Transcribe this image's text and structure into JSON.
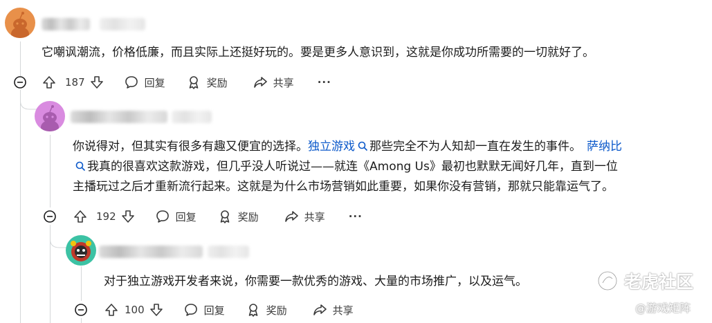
{
  "comments": [
    {
      "text": "它嘲讽潮流，价格低廉，而且实际上还挺好玩的。要是更多人意识到，这就是你成功所需要的一切就好了。",
      "score": "187",
      "reply_label": "回复",
      "award_label": "奖励",
      "share_label": "共享",
      "more_label": "···"
    },
    {
      "text_1": "你说得对，但其实有很多有趣又便宜的选择。",
      "link_1": "独立游戏",
      "text_2": "那些完全不为人知却一直在发生的事件。",
      "link_2": "萨纳比",
      "text_3": "我真的很喜欢这款游戏，但几乎没人听说过——就连《Among Us》最初也默默无闻好几年，直到一位",
      "text_4": "主播玩过之后才重新流行起来。这就是为什么市场营销如此重要，如果你没有营销，那就只能靠运气了。",
      "score": "192",
      "reply_label": "回复",
      "award_label": "奖励",
      "share_label": "共享",
      "more_label": "···"
    },
    {
      "text": "对于独立游戏开发者来说，你需要一款优秀的游戏、大量的市场推广，以及运气。",
      "score": "100",
      "reply_label": "回复",
      "award_label": "奖励",
      "share_label": "共享"
    }
  ],
  "watermark": {
    "site": "老虎社区",
    "handle": "@游戏矩阵"
  },
  "colors": {
    "link": "#0a58ca",
    "avatar_1": "#e8904a",
    "avatar_2": "#d98be0",
    "avatar_3": "#3cc2a4",
    "thread_line": "#d4d7d9"
  }
}
